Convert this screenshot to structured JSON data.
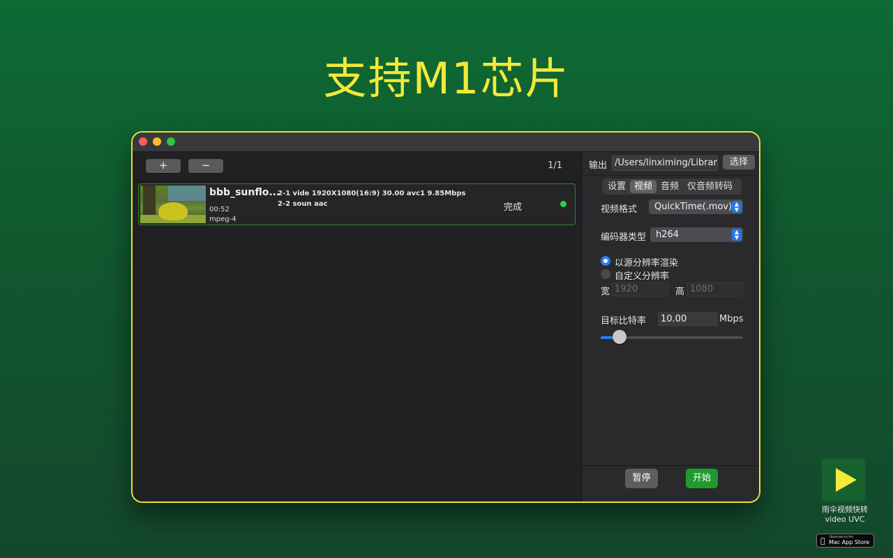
{
  "headline": "支持M1芯片",
  "toolbar": {
    "add_label": "+",
    "remove_label": "−",
    "page_count": "1/1"
  },
  "files": [
    {
      "name": "bbb_sunflo...",
      "duration": "00:52",
      "container": "mpeg-4",
      "streams": [
        "2-1 vide 1920X1080(16:9) 30.00 avc1 9.85Mbps",
        "2-2 soun aac"
      ],
      "status": "完成",
      "status_color": "#2bd34a"
    }
  ],
  "settings": {
    "output_label": "输出",
    "output_path": "/Users/linximing/Library/Containers",
    "choose_label": "选择",
    "tabs": [
      {
        "label": "设置",
        "active": false
      },
      {
        "label": "视频",
        "active": true
      },
      {
        "label": "音频",
        "active": false
      },
      {
        "label": "仅音频转码",
        "active": false
      }
    ],
    "video_format_label": "视频格式",
    "video_format_value": "QuickTime(.mov)",
    "encoder_label": "编码器类型",
    "encoder_value": "h264",
    "resolution_source_label": "以源分辨率渲染",
    "resolution_custom_label": "自定义分辨率",
    "resolution_source_selected": true,
    "width_label": "宽",
    "width_placeholder": "1920",
    "height_label": "高",
    "height_placeholder": "1080",
    "bitrate_label": "目标比特率",
    "bitrate_value": "10.00",
    "bitrate_unit": "Mbps",
    "bitrate_slider_fraction": 0.13,
    "pause_label": "暂停",
    "start_label": "开始"
  },
  "app_badge": {
    "name_line1": "雨伞视频快转",
    "name_line2": "video UVC",
    "store_small": "Download on the",
    "store_big": "Mac App Store"
  },
  "colors": {
    "accent_yellow": "#f2e93a",
    "start_green": "#1f9a2e",
    "select_blue": "#2677e0"
  }
}
